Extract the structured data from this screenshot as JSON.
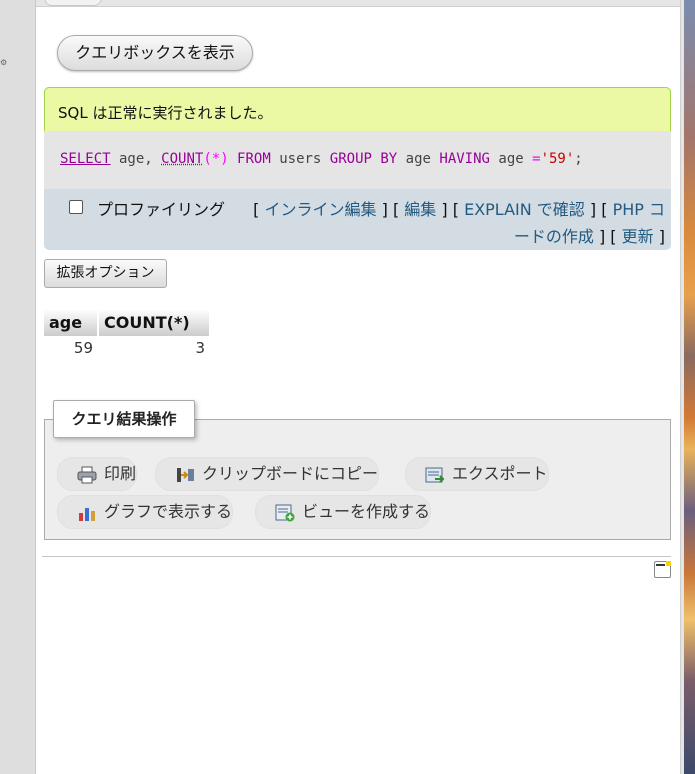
{
  "buttons": {
    "query_box": "クエリボックスを表示",
    "extended_options": "拡張オプション"
  },
  "success": {
    "message": "SQL は正常に実行されました。"
  },
  "sql": {
    "select": "SELECT",
    "age1": " age, ",
    "count": "COUNT",
    "paren_open": "(",
    "star": "*",
    "paren_close": ")",
    "from": " FROM",
    "users": " users ",
    "group_by": "GROUP BY",
    "age2": " age ",
    "having": "HAVING",
    "age3": " age ",
    "eq": "=",
    "value": "'59'",
    "semicolon": ";"
  },
  "tools": {
    "profiling": "プロファイリング",
    "inline_edit": "インライン編集",
    "edit": "編集",
    "explain": "EXPLAIN で確認",
    "php_code_1": "PHP コ",
    "php_code_2": "ードの作成",
    "refresh": "更新",
    "bracket_open": "[",
    "bracket_close": "]",
    "separator": "] ["
  },
  "result": {
    "columns": [
      "age",
      "COUNT(*)"
    ],
    "rows": [
      [
        "59",
        "3"
      ]
    ]
  },
  "operations": {
    "legend": "クエリ結果操作",
    "print": "印刷",
    "copy_clipboard": "クリップボードにコピー",
    "export": "エクスポート",
    "chart": "グラフで表示する",
    "create_view": "ビューを作成する"
  },
  "icons": [
    "print-icon",
    "clipboard-icon",
    "export-icon",
    "chart-icon",
    "create-view-icon",
    "console-icon"
  ]
}
